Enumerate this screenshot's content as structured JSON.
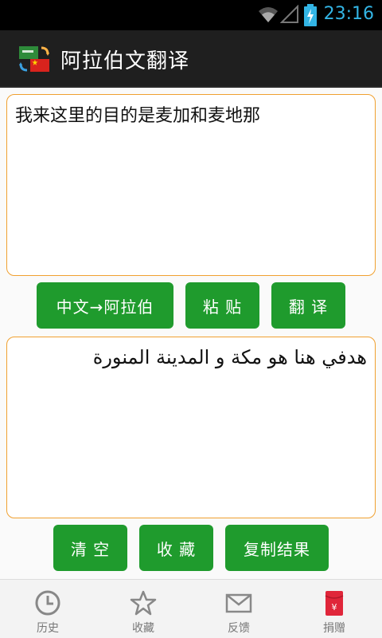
{
  "status_bar": {
    "time": "23:16",
    "accent_color": "#33b5e5"
  },
  "app": {
    "title": "阿拉伯文翻译"
  },
  "source": {
    "text": "我来这里的目的是麦加和麦地那"
  },
  "result": {
    "text": "هدفي هنا هو مكة و المدينة المنورة"
  },
  "buttons": {
    "direction": "中文→阿拉伯",
    "paste": "粘 贴",
    "translate": "翻 译",
    "clear": "清 空",
    "favorite": "收 藏",
    "copy": "复制结果"
  },
  "tabs": [
    {
      "label": "历史",
      "icon": "clock-icon"
    },
    {
      "label": "收藏",
      "icon": "star-icon"
    },
    {
      "label": "反馈",
      "icon": "mail-icon"
    },
    {
      "label": "捐赠",
      "icon": "red-envelope-icon"
    }
  ],
  "colors": {
    "button": "#1f9b2d",
    "input_border": "#f0a030",
    "action_bar": "#1f1f1f"
  }
}
